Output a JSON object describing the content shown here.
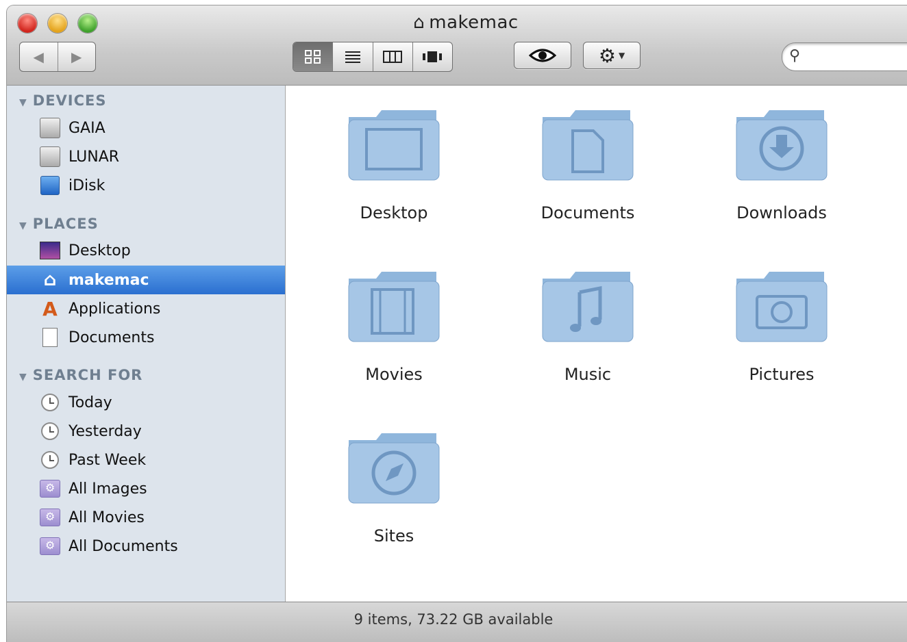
{
  "window": {
    "title": "makemac"
  },
  "toolbar": {
    "back_icon": "back-arrow-icon",
    "forward_icon": "forward-arrow-icon",
    "views": [
      "icon-view",
      "list-view",
      "column-view",
      "coverflow-view"
    ],
    "active_view": "icon-view",
    "quicklook_icon": "eye-icon",
    "action_icon": "gear-icon",
    "search_placeholder": ""
  },
  "sidebar": {
    "devices_header": "DEVICES",
    "devices": [
      {
        "label": "GAIA",
        "icon": "hard-disk-icon"
      },
      {
        "label": "LUNAR",
        "icon": "hard-disk-icon"
      },
      {
        "label": "iDisk",
        "icon": "idisk-icon"
      }
    ],
    "places_header": "PLACES",
    "places": [
      {
        "label": "Desktop",
        "icon": "desktop-icon"
      },
      {
        "label": "makemac",
        "icon": "home-icon",
        "selected": true
      },
      {
        "label": "Applications",
        "icon": "applications-icon"
      },
      {
        "label": "Documents",
        "icon": "document-icon"
      }
    ],
    "search_header": "SEARCH FOR",
    "searches": [
      {
        "label": "Today",
        "icon": "clock-icon"
      },
      {
        "label": "Yesterday",
        "icon": "clock-icon"
      },
      {
        "label": "Past Week",
        "icon": "clock-icon"
      },
      {
        "label": "All Images",
        "icon": "smart-folder-icon"
      },
      {
        "label": "All Movies",
        "icon": "smart-folder-icon"
      },
      {
        "label": "All Documents",
        "icon": "smart-folder-icon"
      }
    ]
  },
  "folders": [
    {
      "label": "Desktop",
      "icon": "desktop-folder-icon"
    },
    {
      "label": "Documents",
      "icon": "documents-folder-icon"
    },
    {
      "label": "Downloads",
      "icon": "downloads-folder-icon"
    },
    {
      "label": "Movies",
      "icon": "movies-folder-icon"
    },
    {
      "label": "Music",
      "icon": "music-folder-icon"
    },
    {
      "label": "Pictures",
      "icon": "pictures-folder-icon"
    },
    {
      "label": "Sites",
      "icon": "sites-folder-icon"
    }
  ],
  "status": {
    "text": "9 items, 73.22 GB available"
  },
  "colors": {
    "selection": "#3a7fdc",
    "sidebar_bg": "#dde4ec",
    "folder_blue": "#8fb6dc"
  }
}
